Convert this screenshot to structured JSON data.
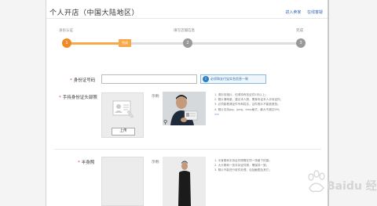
{
  "header": {
    "title": "个人开店（中国大陆地区）",
    "links": [
      "进入卖家",
      "在线答疑"
    ]
  },
  "steps": [
    {
      "label": "身份认证",
      "dot": "1",
      "tag": "完成"
    },
    {
      "label": "填写店铺信息",
      "dot": "2"
    },
    {
      "label": "完成",
      "dot": "3"
    }
  ],
  "form": {
    "id_number": {
      "label": "身份证号码",
      "value": "",
      "hint": "必须和支付宝实名信息一致"
    },
    "handheld": {
      "label": "手持身份证头部照",
      "upload_label": "上传",
      "sample_label": "示例:",
      "tips": [
        "1. 请手持相片，但请持有效证件5天以上；",
        "2. 照片清晰度，建议本人照，需身份证本人手持证件；",
        "3. 必须能看清证件号和姓名，证件照片不能被遮挡；",
        "4. 照片支持jpg、jpeg、bmp格式，最大不超过5M；"
      ],
      "more": ">>"
    },
    "half_body": {
      "label": "半身照",
      "sample_label": "示例:",
      "tips": [
        "1. 半身照和手持证件照需在同一场景下拍摄；",
        "2. 大头照和一张手持证件照，需保持一致；",
        "3. 照片不能进行软件处理，包括截图及其它；"
      ]
    }
  },
  "colors": {
    "accent": "#f08a24",
    "link": "#3066b4",
    "required": "#e23b2e"
  },
  "watermark": {
    "text": "Baidu 经验"
  }
}
